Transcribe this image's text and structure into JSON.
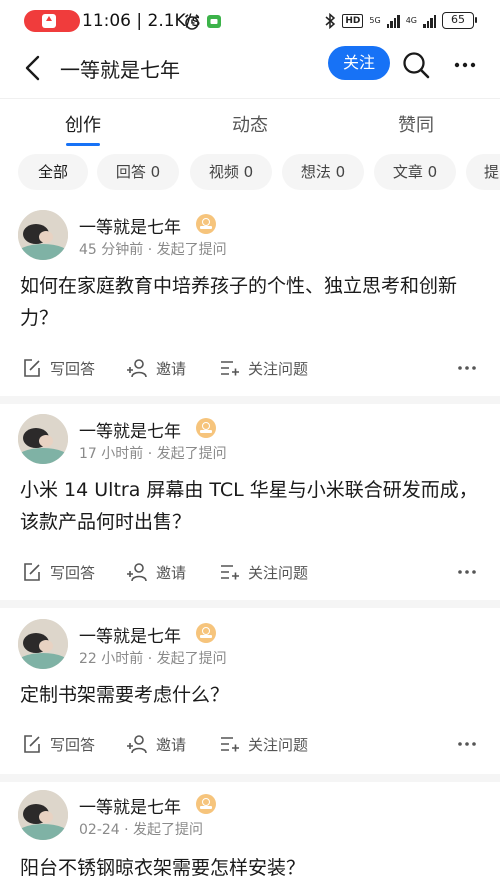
{
  "status_bar": {
    "time": "11:06 | 2.1K/s",
    "network_1": "5G",
    "network_2": "4G",
    "hd_label": "HD",
    "battery": "65",
    "icons": [
      "screen-record-icon",
      "alarm-icon",
      "app-notification-icon",
      "bluetooth-icon"
    ]
  },
  "header": {
    "title": "一等就是七年",
    "follow_label": "关注",
    "icons": [
      "back-icon",
      "search-icon",
      "more-icon"
    ]
  },
  "tabs": [
    {
      "label": "创作",
      "active": true
    },
    {
      "label": "动态",
      "active": false
    },
    {
      "label": "赞同",
      "active": false
    }
  ],
  "filters": [
    {
      "label": "全部",
      "active": true
    },
    {
      "label": "回答 0"
    },
    {
      "label": "视频 0"
    },
    {
      "label": "想法 0"
    },
    {
      "label": "文章 0"
    },
    {
      "label": "提"
    }
  ],
  "actions": {
    "answer": "写回答",
    "invite": "邀请",
    "follow_question": "关注问题"
  },
  "accent_color": "#1772f6",
  "feed": [
    {
      "author": "一等就是七年",
      "meta": "45 分钟前 · 发起了提问",
      "question": "如何在家庭教育中培养孩子的个性、独立思考和创新力？"
    },
    {
      "author": "一等就是七年",
      "meta": "17 小时前 · 发起了提问",
      "question": "小米 14 Ultra 屏幕由 TCL 华星与小米联合研发而成，该款产品何时出售？"
    },
    {
      "author": "一等就是七年",
      "meta": "22 小时前 · 发起了提问",
      "question": "定制书架需要考虑什么？"
    },
    {
      "author": "一等就是七年",
      "meta": "02-24 · 发起了提问",
      "question": "阳台不锈钢晾衣架需要怎样安装？"
    }
  ]
}
